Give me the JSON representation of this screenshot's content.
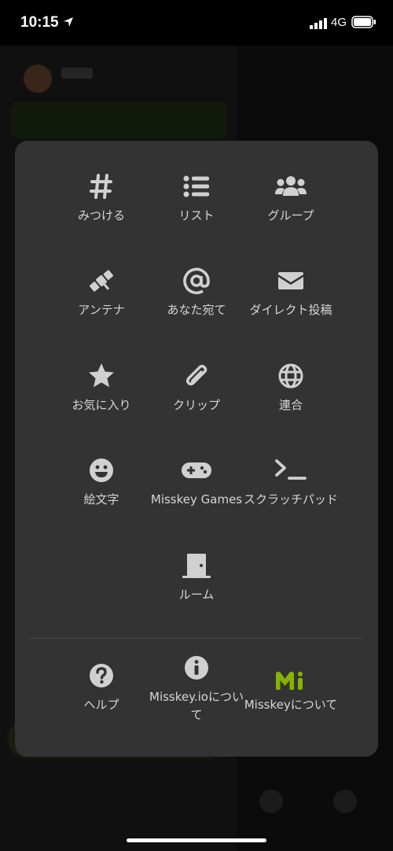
{
  "status": {
    "time": "10:15",
    "network": "4G"
  },
  "menu": {
    "items": [
      {
        "label": "みつける",
        "icon": "hashtag-icon"
      },
      {
        "label": "リスト",
        "icon": "list-icon"
      },
      {
        "label": "グループ",
        "icon": "users-icon"
      },
      {
        "label": "アンテナ",
        "icon": "satellite-icon"
      },
      {
        "label": "あなた宛て",
        "icon": "at-icon"
      },
      {
        "label": "ダイレクト投稿",
        "icon": "envelope-icon"
      },
      {
        "label": "お気に入り",
        "icon": "star-icon"
      },
      {
        "label": "クリップ",
        "icon": "paperclip-icon"
      },
      {
        "label": "連合",
        "icon": "globe-icon"
      },
      {
        "label": "絵文字",
        "icon": "smile-icon"
      },
      {
        "label": "Misskey Games",
        "icon": "gamepad-icon"
      },
      {
        "label": "スクラッチパッド",
        "icon": "terminal-icon"
      },
      {
        "label": "ルーム",
        "icon": "door-icon"
      }
    ],
    "footer": [
      {
        "label": "ヘルプ",
        "icon": "question-icon"
      },
      {
        "label": "Misskey.ioについて",
        "icon": "info-icon"
      },
      {
        "label": "Misskeyについて",
        "icon": "misskey-logo-icon",
        "color": "#86b300"
      }
    ],
    "colors": {
      "background": "#333333",
      "icon": "#d0d0d0",
      "accent": "#86b300"
    }
  }
}
